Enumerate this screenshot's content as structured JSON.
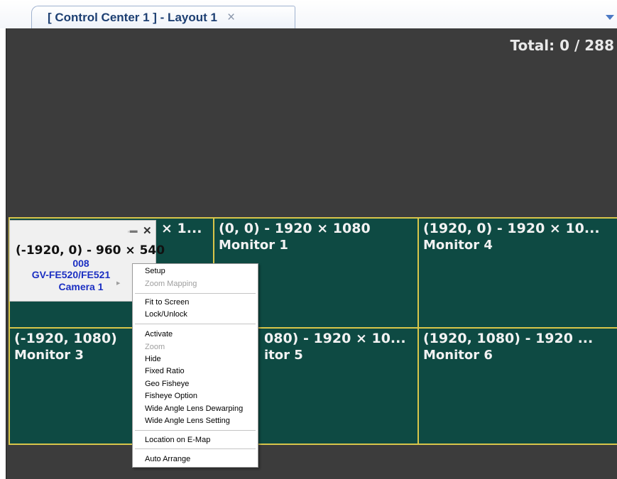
{
  "tab": {
    "title": "[ Control Center 1 ] - Layout 1",
    "close_icon": "×"
  },
  "workspace": {
    "total_label": "Total: 0 / 288"
  },
  "monitors": [
    {
      "coords": "(-1920, 0) - 960 × 540",
      "visible_coords": "× 1...",
      "name": ""
    },
    {
      "coords": "(0, 0) - 1920 × 1080",
      "name": "Monitor 1"
    },
    {
      "coords": "(1920, 0) - 1920 × 10...",
      "name": "Monitor 4"
    },
    {
      "coords": "(-1920, 1080)",
      "name": "Monitor 3"
    },
    {
      "coords": "080) - 1920 × 10...",
      "name": "itor 5"
    },
    {
      "coords": "(1920, 1080) - 1920 ...",
      "name": "Monitor 6"
    }
  ],
  "camera_popup": {
    "resolution": "(-1920, 0) - 960 × 540",
    "channel": "008",
    "model": "GV-FE520/FE521",
    "camera_name": "Camera 1"
  },
  "context_menu": {
    "items": [
      {
        "label": "Setup",
        "enabled": true
      },
      {
        "label": "Zoom Mapping",
        "enabled": false,
        "has_submenu": true
      },
      {
        "label": "Fit to Screen",
        "enabled": true
      },
      {
        "label": "Lock/Unlock",
        "enabled": true
      },
      {
        "label": "Activate",
        "enabled": true
      },
      {
        "label": "Zoom",
        "enabled": false
      },
      {
        "label": "Hide",
        "enabled": true
      },
      {
        "label": "Fixed Ratio",
        "enabled": true
      },
      {
        "label": "Geo Fisheye",
        "enabled": true
      },
      {
        "label": "Fisheye Option",
        "enabled": true
      },
      {
        "label": "Wide Angle Lens Dewarping",
        "enabled": true
      },
      {
        "label": "Wide Angle Lens Setting",
        "enabled": true
      },
      {
        "label": "Location on E-Map",
        "enabled": true
      },
      {
        "label": "Auto Arrange",
        "enabled": true
      }
    ]
  },
  "colors": {
    "monitor_bg": "#0e4a43",
    "monitor_border": "#d8c54a",
    "workspace_bg": "#3c3c3c",
    "camera_text": "#1b2fc2"
  }
}
